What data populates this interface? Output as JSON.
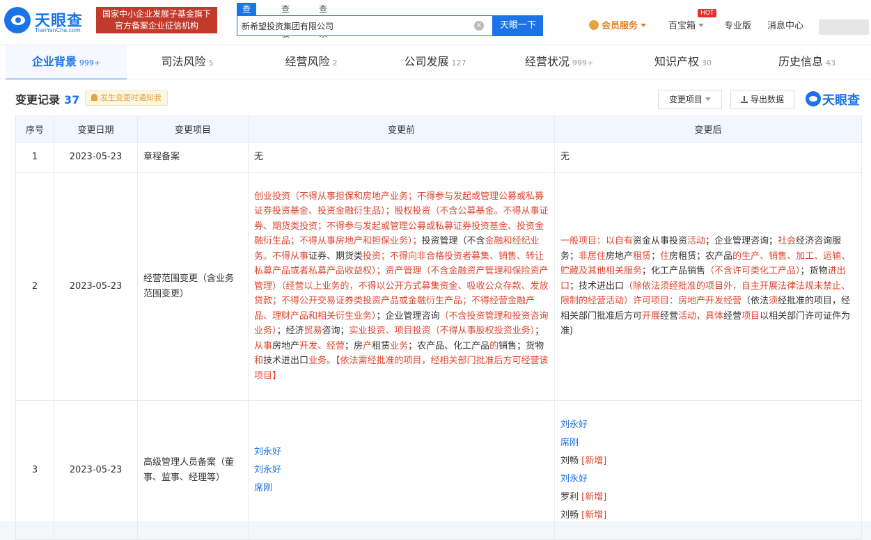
{
  "header": {
    "logo_cn": "天眼查",
    "logo_en": "TianYanCha.com",
    "slogan_line1": "国家中小企业发展子基金旗下",
    "slogan_line2": "官方备案企业征信机构",
    "search_tabs": [
      "查公司",
      "查老板",
      "查关系"
    ],
    "search_value": "新希望投资集团有限公司",
    "search_button": "天眼一下",
    "vip": "会员服务",
    "baibaoxiang": "百宝箱",
    "hot": "HOT",
    "pro": "专业版",
    "messages": "消息中心"
  },
  "tabs": [
    {
      "label": "企业背景",
      "count": "999+"
    },
    {
      "label": "司法风险",
      "count": "5"
    },
    {
      "label": "经营风险",
      "count": "2"
    },
    {
      "label": "公司发展",
      "count": "127"
    },
    {
      "label": "经营状况",
      "count": "999+"
    },
    {
      "label": "知识产权",
      "count": "30"
    },
    {
      "label": "历史信息",
      "count": "43"
    }
  ],
  "section": {
    "title": "变更记录",
    "count": "37",
    "notify": "发生变更时通知我",
    "filter_button": "变更项目",
    "export_button": "导出数据",
    "watermark": "天眼查"
  },
  "table": {
    "headers": [
      "序号",
      "变更日期",
      "变更项目",
      "变更前",
      "变更后"
    ],
    "rows": [
      {
        "no": "1",
        "date": "2023-05-23",
        "item": "章程备案",
        "before": "无",
        "after": "无"
      },
      {
        "no": "2",
        "date": "2023-05-23",
        "item": "经营范围变更（含业务范围变更）",
        "before_segments": [
          {
            "t": "创业投资（不得从事担保和房地产业务；不得参与发起或管理公募或私募证券投资基金、投资金融衍生品）；股权投资（不含公募基金。不得从事证券、期货类投资；不得参与发起或管理公募或私募证券投资基金、投资金融衍生品；不得从事房地产和担保业务）；",
            "r": true
          },
          {
            "t": "投资管理（不含",
            "r": false
          },
          {
            "t": "金融和经纪业务。不得从事",
            "r": true
          },
          {
            "t": "证券、期货类",
            "r": false
          },
          {
            "t": "投资；不得向非合格投资者募集、销售、转让私募产品或者私募产品收益权）；资产管理（不含金融资产管理和保险资产管理）（经营以上业务的，不得以公开方式募集资金、吸收公众存款、发放贷款；不得公开交易证券类投资产品或金融衍生产品；不得经营金融产品、理财产品和相关衍生业务）",
            "r": true
          },
          {
            "t": "；企业管理咨询",
            "r": false
          },
          {
            "t": "（不含投资管理和投资咨询业务）",
            "r": true
          },
          {
            "t": "；经济",
            "r": false
          },
          {
            "t": "贸易",
            "r": true
          },
          {
            "t": "咨询；",
            "r": false
          },
          {
            "t": "实业投资、项目投资（不得从事股权投资业务）",
            "r": true
          },
          {
            "t": "；",
            "r": false
          },
          {
            "t": "从事",
            "r": true
          },
          {
            "t": "房地产",
            "r": false
          },
          {
            "t": "开发、经营",
            "r": true
          },
          {
            "t": "；房",
            "r": false
          },
          {
            "t": "产",
            "r": true
          },
          {
            "t": "租赁",
            "r": false
          },
          {
            "t": "业务",
            "r": true
          },
          {
            "t": "；农产品、化工产品",
            "r": false
          },
          {
            "t": "的",
            "r": true
          },
          {
            "t": "销售；货物",
            "r": false
          },
          {
            "t": "和",
            "r": true
          },
          {
            "t": "技术进出口",
            "r": false
          },
          {
            "t": "业务。【依法需经批准的项目，经相关部门批准后方可经营该项目】",
            "r": true
          }
        ],
        "after_segments": [
          {
            "t": "一般项目：以自有",
            "r": true
          },
          {
            "t": "资金从事投资",
            "r": false
          },
          {
            "t": "活动",
            "r": true
          },
          {
            "t": "；企业管理咨询；",
            "r": false
          },
          {
            "t": "社会",
            "r": true
          },
          {
            "t": "经济咨询服务；",
            "r": false
          },
          {
            "t": "非居住",
            "r": true
          },
          {
            "t": "房地产",
            "r": false
          },
          {
            "t": "租赁",
            "r": true
          },
          {
            "t": "；",
            "r": false
          },
          {
            "t": "住",
            "r": true
          },
          {
            "t": "房租赁；农产品",
            "r": false
          },
          {
            "t": "的生产、销售、加工、运输、贮藏及其他相关服务",
            "r": true
          },
          {
            "t": "；化工产品销售",
            "r": false
          },
          {
            "t": "（不含许可类化工产品）",
            "r": true
          },
          {
            "t": "；货物",
            "r": false
          },
          {
            "t": "进出口",
            "r": true
          },
          {
            "t": "；技术进出口",
            "r": false
          },
          {
            "t": "（除依法须经批准的项目外，自主开展法律法规未禁止、限制的经营活动）许可项目：房地产开发经营",
            "r": true
          },
          {
            "t": "（依法",
            "r": false
          },
          {
            "t": "须",
            "r": true
          },
          {
            "t": "经批准的项目，经相关部门批准后方可",
            "r": false
          },
          {
            "t": "开展",
            "r": true
          },
          {
            "t": "经营",
            "r": false
          },
          {
            "t": "活动，具体",
            "r": true
          },
          {
            "t": "经营",
            "r": false
          },
          {
            "t": "项目",
            "r": true
          },
          {
            "t": "以相关部门许可证件为准)",
            "r": false
          }
        ]
      },
      {
        "no": "3",
        "date": "2023-05-23",
        "item": "高级管理人员备案（董事、监事、经理等）",
        "before_people": [
          {
            "name": "刘永好",
            "link": true,
            "tag": ""
          },
          {
            "name": "刘永好",
            "link": true,
            "tag": ""
          },
          {
            "name": "席刚",
            "link": true,
            "tag": ""
          }
        ],
        "after_people": [
          {
            "name": "刘永好",
            "link": true,
            "tag": ""
          },
          {
            "name": "席刚",
            "link": true,
            "tag": ""
          },
          {
            "name": "刘畅",
            "link": false,
            "tag": "[新增]"
          },
          {
            "name": "刘永好",
            "link": true,
            "tag": ""
          },
          {
            "name": "罗利",
            "link": false,
            "tag": "[新增]"
          },
          {
            "name": "刘畅",
            "link": false,
            "tag": "[新增]"
          }
        ]
      }
    ]
  }
}
